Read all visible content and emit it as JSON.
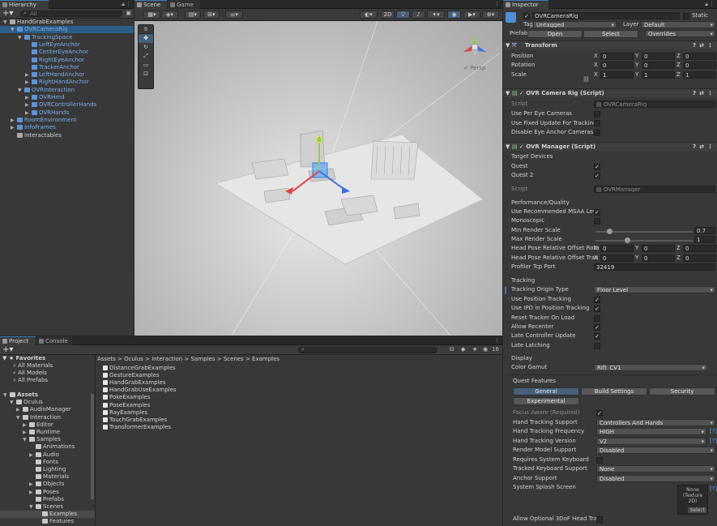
{
  "hierarchy": {
    "tab": "Hierarchy",
    "search_placeholder": "All",
    "items": [
      {
        "label": "HandGrabExamples",
        "indent": 0,
        "arrow": "▼",
        "color": "#d2d2d2",
        "sel": false
      },
      {
        "label": "OVRCameraRig",
        "indent": 1,
        "arrow": "▼",
        "color": "#7dade9",
        "sel": true
      },
      {
        "label": "TrackingSpace",
        "indent": 2,
        "arrow": "▼",
        "color": "#7dade9",
        "sel": false
      },
      {
        "label": "LeftEyeAnchor",
        "indent": 3,
        "arrow": "",
        "color": "#7dade9",
        "sel": false
      },
      {
        "label": "CenterEyeAnchor",
        "indent": 3,
        "arrow": "",
        "color": "#7dade9",
        "sel": false
      },
      {
        "label": "RightEyeAnchor",
        "indent": 3,
        "arrow": "",
        "color": "#7dade9",
        "sel": false
      },
      {
        "label": "TrackerAnchor",
        "indent": 3,
        "arrow": "",
        "color": "#7dade9",
        "sel": false
      },
      {
        "label": "LeftHandAnchor",
        "indent": 3,
        "arrow": "▶",
        "color": "#7dade9",
        "sel": false
      },
      {
        "label": "RightHandAnchor",
        "indent": 3,
        "arrow": "▶",
        "color": "#7dade9",
        "sel": false
      },
      {
        "label": "OVRInteraction",
        "indent": 2,
        "arrow": "▼",
        "color": "#7dade9",
        "sel": false
      },
      {
        "label": "OVRHmd",
        "indent": 3,
        "arrow": "▶",
        "color": "#7dade9",
        "sel": false
      },
      {
        "label": "OVRControllerHands",
        "indent": 3,
        "arrow": "▶",
        "color": "#7dade9",
        "sel": false
      },
      {
        "label": "OVRHands",
        "indent": 3,
        "arrow": "▶",
        "color": "#7dade9",
        "sel": false
      },
      {
        "label": "RoomEnvironment",
        "indent": 1,
        "arrow": "▶",
        "color": "#7dade9",
        "sel": false
      },
      {
        "label": "InfoFrames",
        "indent": 1,
        "arrow": "▶",
        "color": "#7dade9",
        "sel": false
      },
      {
        "label": "Interactables",
        "indent": 1,
        "arrow": "",
        "color": "#d2d2d2",
        "sel": false
      }
    ]
  },
  "scene": {
    "tab_scene": "Scene",
    "tab_game": "Game",
    "btn_2d": "2D",
    "persp": "< Persp"
  },
  "project": {
    "tab_project": "Project",
    "tab_console": "Console",
    "favorites": "Favorites",
    "fav_items": [
      "All Materials",
      "All Models",
      "All Prefabs"
    ],
    "assets": "Assets",
    "badge": "16",
    "tree": [
      {
        "label": "Assets",
        "indent": 0,
        "arrow": "▼"
      },
      {
        "label": "Oculus",
        "indent": 1,
        "arrow": "▼"
      },
      {
        "label": "AudioManager",
        "indent": 2,
        "arrow": "▶"
      },
      {
        "label": "Interaction",
        "indent": 2,
        "arrow": "▼"
      },
      {
        "label": "Editor",
        "indent": 3,
        "arrow": "▶"
      },
      {
        "label": "Runtime",
        "indent": 3,
        "arrow": "▶"
      },
      {
        "label": "Samples",
        "indent": 3,
        "arrow": "▼"
      },
      {
        "label": "Animations",
        "indent": 4,
        "arrow": ""
      },
      {
        "label": "Audio",
        "indent": 4,
        "arrow": "▶"
      },
      {
        "label": "Fonts",
        "indent": 4,
        "arrow": ""
      },
      {
        "label": "Lighting",
        "indent": 4,
        "arrow": ""
      },
      {
        "label": "Materials",
        "indent": 4,
        "arrow": ""
      },
      {
        "label": "Objects",
        "indent": 4,
        "arrow": "▶"
      },
      {
        "label": "Poses",
        "indent": 4,
        "arrow": "▶"
      },
      {
        "label": "Prefabs",
        "indent": 4,
        "arrow": ""
      },
      {
        "label": "Scenes",
        "indent": 4,
        "arrow": "▼"
      },
      {
        "label": "Examples",
        "indent": 5,
        "arrow": ""
      },
      {
        "label": "Features",
        "indent": 5,
        "arrow": ""
      }
    ],
    "breadcrumb": "Assets > Oculus > Interaction > Samples > Scenes > Examples",
    "files": [
      "DistanceGrabExamples",
      "GestureExamples",
      "HandGrabExamples",
      "HandGrabUseExamples",
      "PokeExamples",
      "PoseExamples",
      "RayExamples",
      "TouchGrabExamples",
      "TransformerExamples"
    ]
  },
  "inspector": {
    "tab": "Inspector",
    "object_name": "OVRCameraRig",
    "static": "Static",
    "tag_label": "Tag",
    "tag": "Untagged",
    "layer_label": "Layer",
    "layer": "Default",
    "prefab_label": "Prefab",
    "open": "Open",
    "select": "Select",
    "overrides": "Overrides",
    "transform": {
      "title": "Transform",
      "position": "Position",
      "rotation": "Rotation",
      "scale": "Scale",
      "pos": [
        "0",
        "0",
        "0"
      ],
      "rot": [
        "0",
        "0",
        "0"
      ],
      "scl": [
        "1",
        "1",
        "1"
      ]
    },
    "rig": {
      "title": "OVR Camera Rig (Script)",
      "script_label": "Script",
      "script": "OVRCameraRig",
      "opts": [
        "Use Per Eye Cameras",
        "Use Fixed Update For Tracking",
        "Disable Eye Anchor Cameras"
      ]
    },
    "manager": {
      "title": "OVR Manager (Script)",
      "target_devices": "Target Devices",
      "quest": "Quest",
      "quest2": "Quest 2",
      "script_label": "Script",
      "script": "OVRManager",
      "perf": "Performance/Quality",
      "msaa": "Use Recommended MSAA Leve",
      "mono": "Monoscopic",
      "min_render": "Min Render Scale",
      "min_val": "0.7",
      "max_render": "Max Render Scale",
      "max_val": "1",
      "hp_rot": "Head Pose Relative Offset Rota",
      "hp_trans": "Head Pose Relative Offset Tran",
      "profiler": "Profiler Tcp Port",
      "port": "32419",
      "tracking": "Tracking",
      "origin_label": "Tracking Origin Type",
      "origin": "Floor Level",
      "use_pos": "Use Position Tracking",
      "use_ipd": "Use IPD in Position Tracking",
      "reset": "Reset Tracker On Load",
      "recenter": "Allow Recenter",
      "late_ctrl": "Late Controller Update",
      "late_latch": "Late Latching",
      "display": "Display",
      "gamut_label": "Color Gamut",
      "gamut": "Rift_CV1",
      "quest_features": "Quest Features",
      "tab_general": "General",
      "tab_build": "Build Settings",
      "tab_security": "Security",
      "tab_exp": "Experimental",
      "focus": "Focus Aware (Required)",
      "hts": "Hand Tracking Support",
      "hts_val": "Controllers And Hands",
      "htf": "Hand Tracking Frequency",
      "htf_val": "HIGH",
      "htv": "Hand Tracking Version",
      "htv_val": "V2",
      "rms": "Render Model Support",
      "rms_val": "Disabled",
      "rsk": "Requires System Keyboard",
      "tks": "Tracked Keyboard Support",
      "tks_val": "None",
      "anc": "Anchor Support",
      "anc_val": "Disabled",
      "splash": "System Splash Screen",
      "splash_none": "None",
      "splash_type": "(Texture 2D)",
      "splash_select": "Select",
      "allow3dof": "Allow Optional 3DoF Head Trac"
    }
  },
  "colors": {
    "selection": "#2c5d87",
    "accent": "#3a79bb",
    "bg": "#383838"
  }
}
